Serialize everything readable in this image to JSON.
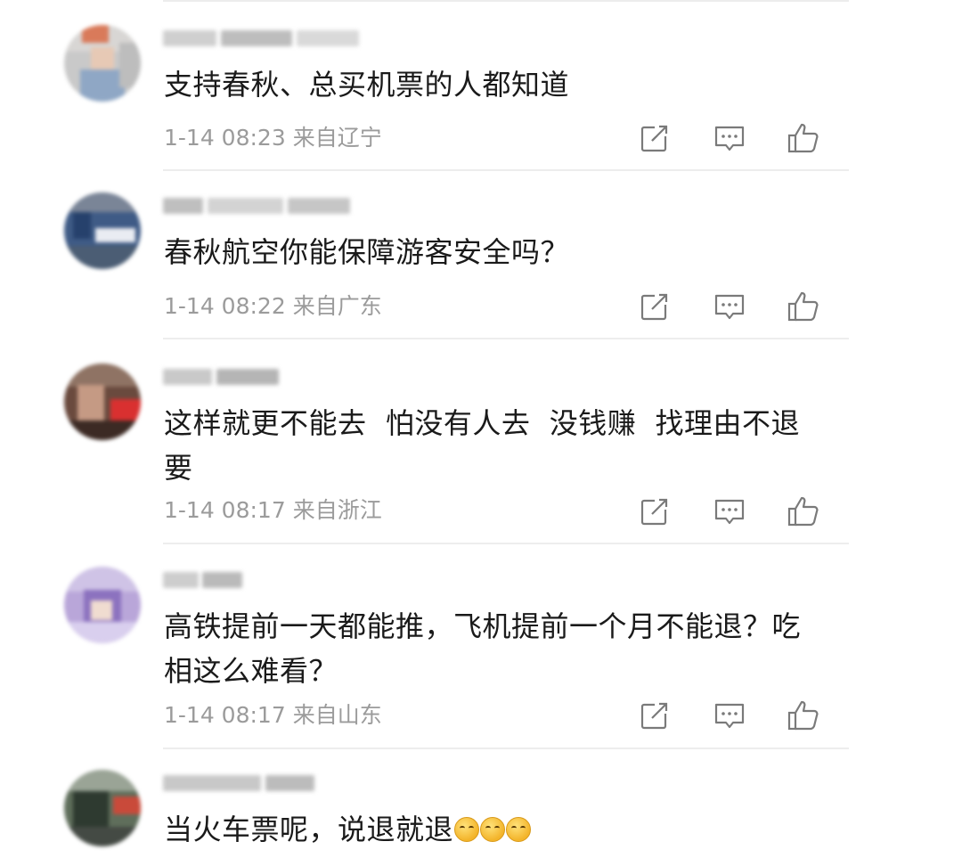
{
  "comments": [
    {
      "text": "支持春秋、总买机票的人都知道",
      "time": "1-14 08:23",
      "location": "来自辽宁"
    },
    {
      "text": "春秋航空你能保障游客安全吗？",
      "time": "1-14 08:22",
      "location": "来自广东"
    },
    {
      "text": "这样就更不能去  怕没有人去  没钱赚  找理由不退要",
      "time": "1-14 08:17",
      "location": "来自浙江"
    },
    {
      "text": "高铁提前一天都能推，飞机提前一个月不能退？吃相这么难看？",
      "time": "1-14 08:17",
      "location": "来自山东"
    },
    {
      "text": "当火车票呢，说退就退",
      "emoji_count": 3
    }
  ],
  "icons": {
    "share": "share-icon",
    "comment": "comment-icon",
    "like": "thumbs-up-icon"
  },
  "colors": {
    "meta_text": "#9b9b9b",
    "icon_stroke": "#7a7a7a",
    "divider": "#ededed"
  }
}
